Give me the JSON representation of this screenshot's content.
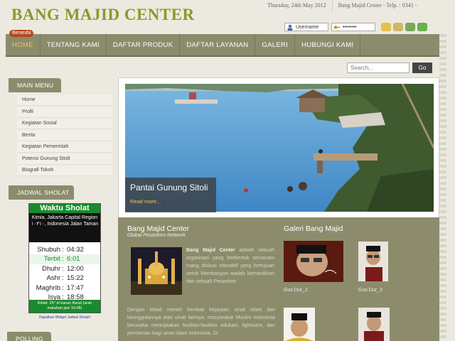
{
  "header": {
    "site_title": "BANG MAJID CENTER",
    "date": "Thursday, 24th May 2012",
    "contact": "Bang Majid Center - Telp. : 0341 -",
    "username_placeholder": "Username",
    "password_mask": "••••••••"
  },
  "nav": {
    "active_tag": "Beranda",
    "items": [
      "HOME",
      "TENTANG KAMI",
      "DAFTAR PRODUK",
      "DAFTAR LAYANAN",
      "GALERI",
      "HUBUNGI KAMI"
    ]
  },
  "search": {
    "placeholder": "Search...",
    "button": "Go"
  },
  "sidebar": {
    "main_menu_title": "MAIN MENU",
    "menu_items": [
      "Home",
      "Profil",
      "Kegiatan Sosial",
      "Berita",
      "Kegiatan Pemerintah",
      "Potensi Gunung Sitoli",
      "Biografi Tokoh"
    ],
    "jadwal_title": "JADWAL SHOLAT",
    "polling_title": "POLLING"
  },
  "sholat": {
    "title": "Waktu Sholat",
    "location": "Kimia, Jakarta Capital Region ١٠٣١٠, Indonesia Jalan Taman",
    "times": [
      {
        "name": "Shubuh",
        "time": "04:32"
      },
      {
        "name": "Terbit",
        "time": "6:01"
      },
      {
        "name": "Dhuhr",
        "time": "12:00"
      },
      {
        "name": "Ashr",
        "time": "15:22"
      },
      {
        "name": "Maghrib",
        "time": "17:47"
      },
      {
        "name": "Isya",
        "time": "18:58"
      }
    ],
    "kiblat": "Kiblat: 25° di kanan Barat (arah matahari jam 16:08)",
    "widget_link": "Dapatkan Widget Jadwal Sholat!"
  },
  "slider": {
    "caption": "Pantai Gunung Sitoli",
    "read_more": "Read more..."
  },
  "article": {
    "title": "Bang Majid Center",
    "subtitle": "Global Pesantren Network",
    "p1_bold": "Bang Majid Center",
    "p1": " adalah sebuah organisasi yang berbentuk semacam ruang diskusi interaktif yang bertujuan untuk Membangun wadah kemandirian dan sebuah Pesantren",
    "p2": "Dengan tekad meraih kembali kejayaan umat islam dan keunggulannya atas umat lainnya, masyarakat Muslim Indonesia berusaha menciptakan fasilitas-fasilitas edukasi, lightment, dan pemberian bagi umat Islam Indonesia. Di"
  },
  "gallery": {
    "title": "Galeri Bang Majid",
    "captions": [
      "Gus Dur_2",
      "Gus Dur_3"
    ]
  },
  "colors": {
    "accent_green": "#8a9a2a",
    "nav_bg": "#8c8c6c",
    "active_nav": "#e8c75a",
    "sholat_green": "#1a8a2e"
  }
}
